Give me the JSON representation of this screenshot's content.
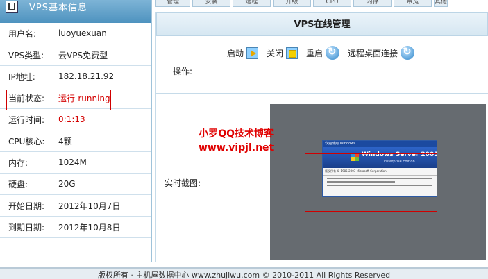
{
  "sidebar": {
    "title": "VPS基本信息",
    "rows": [
      {
        "label": "用户名:",
        "value": "luoyuexuan"
      },
      {
        "label": "VPS类型:",
        "value": "云VPS免费型"
      },
      {
        "label": "IP地址:",
        "value": "182.18.21.92"
      },
      {
        "label": "当前状态:",
        "value": "运行-running"
      },
      {
        "label": "运行时间:",
        "value": "0:1:13"
      },
      {
        "label": "CPU核心:",
        "value": "4颗"
      },
      {
        "label": "内存:",
        "value": "1024M"
      },
      {
        "label": "硬盘:",
        "value": "20G"
      },
      {
        "label": "开始日期:",
        "value": "2012年10月7日"
      },
      {
        "label": "到期日期:",
        "value": "2012年10月8日"
      }
    ]
  },
  "tabs": [
    "管理",
    "安装",
    "远程",
    "升级",
    "CPU",
    "内存",
    "带宽",
    "其他"
  ],
  "panel": {
    "title": "VPS在线管理",
    "ops_label": "操作:",
    "ops": {
      "start": "启动",
      "stop": "关闭",
      "restart": "重启",
      "remote": "远程桌面连接"
    },
    "snapshot_label": "实时截图:",
    "screenshot": {
      "titlebar": "欢迎使用 Windows",
      "product": "Windows Server 2003",
      "edition": "Enterprise Edition",
      "copyright": "版权所有 © 1985-2003 Microsoft Corporation"
    }
  },
  "watermark": {
    "line1": "小罗QQ技术博客",
    "line2": "www.vipjl.net"
  },
  "footer": "版权所有 · 主机屋数据中心 www.zhujiwu.com © 2010-2011 All Rights Reserved"
}
